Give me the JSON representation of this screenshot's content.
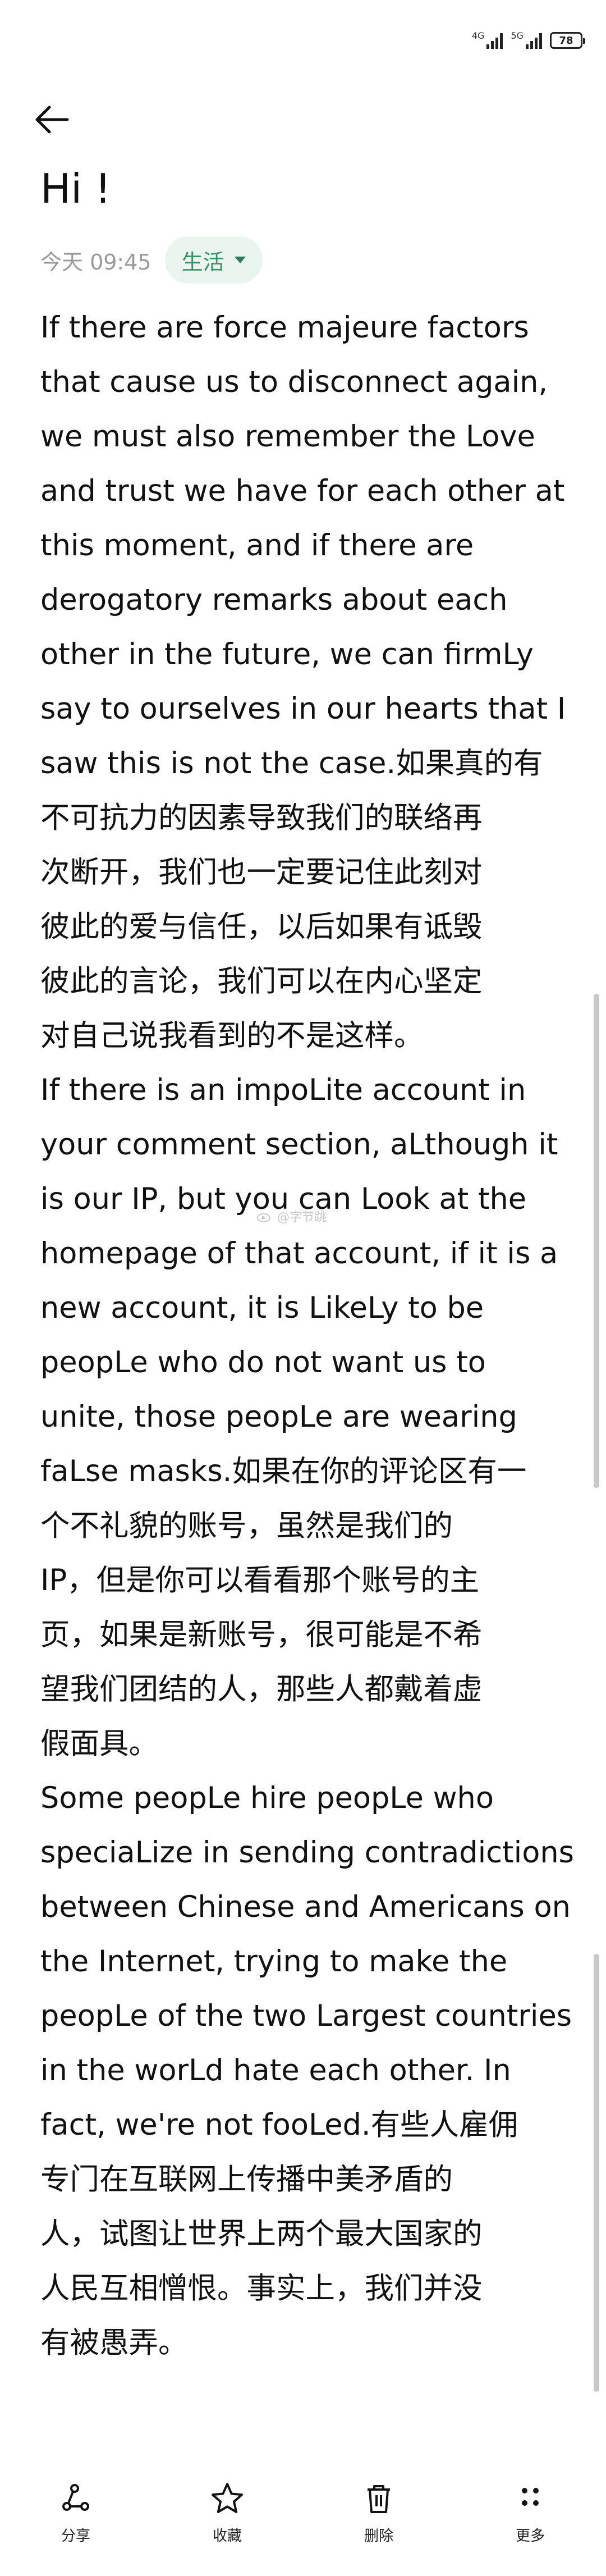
{
  "status_bar": {
    "network_label": "4G",
    "network_label_2": "5G",
    "battery": "78"
  },
  "note": {
    "title": "Hi !",
    "timestamp": "今天 09:45",
    "category": "生活",
    "lines": [
      "If there are force majeure factors",
      "that cause us to disconnect again,",
      "we must also remember the Love",
      "and trust we have for each other at",
      "this moment, and if there are",
      "derogatory remarks about each",
      "other in the future, we can firmLy",
      "say to ourselves in our hearts that I",
      "saw this is not the case.如果真的有",
      "不可抗力的因素导致我们的联络再",
      "次断开，我们也一定要记住此刻对",
      "彼此的爱与信任，以后如果有诋毁",
      "彼此的言论，我们可以在内心坚定",
      "对自己说我看到的不是这样。",
      "If there is an impoLite account in",
      "your comment section, aLthough it",
      "is our IP, but you can Look at the",
      "homepage of that account, if it is a",
      "new account, it is LikeLy to be",
      "peopLe who do not want us to",
      "unite, those peopLe are wearing",
      "faLse masks.如果在你的评论区有一",
      "个不礼貌的账号，虽然是我们的",
      "IP，但是你可以看看那个账号的主",
      "页，如果是新账号，很可能是不希",
      "望我们团结的人，那些人都戴着虚",
      "假面具。",
      "Some peopLe hire peopLe who",
      "speciaLize in sending contradictions",
      "between Chinese and Americans on",
      "the Internet, trying to make the",
      "peopLe of the two Largest countries",
      "in the worLd hate each other. In",
      "fact, we're not fooLed.有些人雇佣",
      "专门在互联网上传播中美矛盾的",
      "人，试图让世界上两个最大国家的",
      "人民互相憎恨。事实上，我们并没",
      "有被愚弄。"
    ]
  },
  "watermark": "@字节跳",
  "toolbar": {
    "share_label": "分享",
    "favorite_label": "收藏",
    "delete_label": "删除",
    "more_label": "更多"
  },
  "icons": [
    "back-arrow-icon",
    "chevron-down-icon",
    "share-icon",
    "star-icon",
    "trash-icon",
    "more-dots-icon"
  ],
  "colors": {
    "pill_bg": "#e9f4ee",
    "pill_text": "#3f8f68",
    "meta_text": "#9a9a9a"
  }
}
